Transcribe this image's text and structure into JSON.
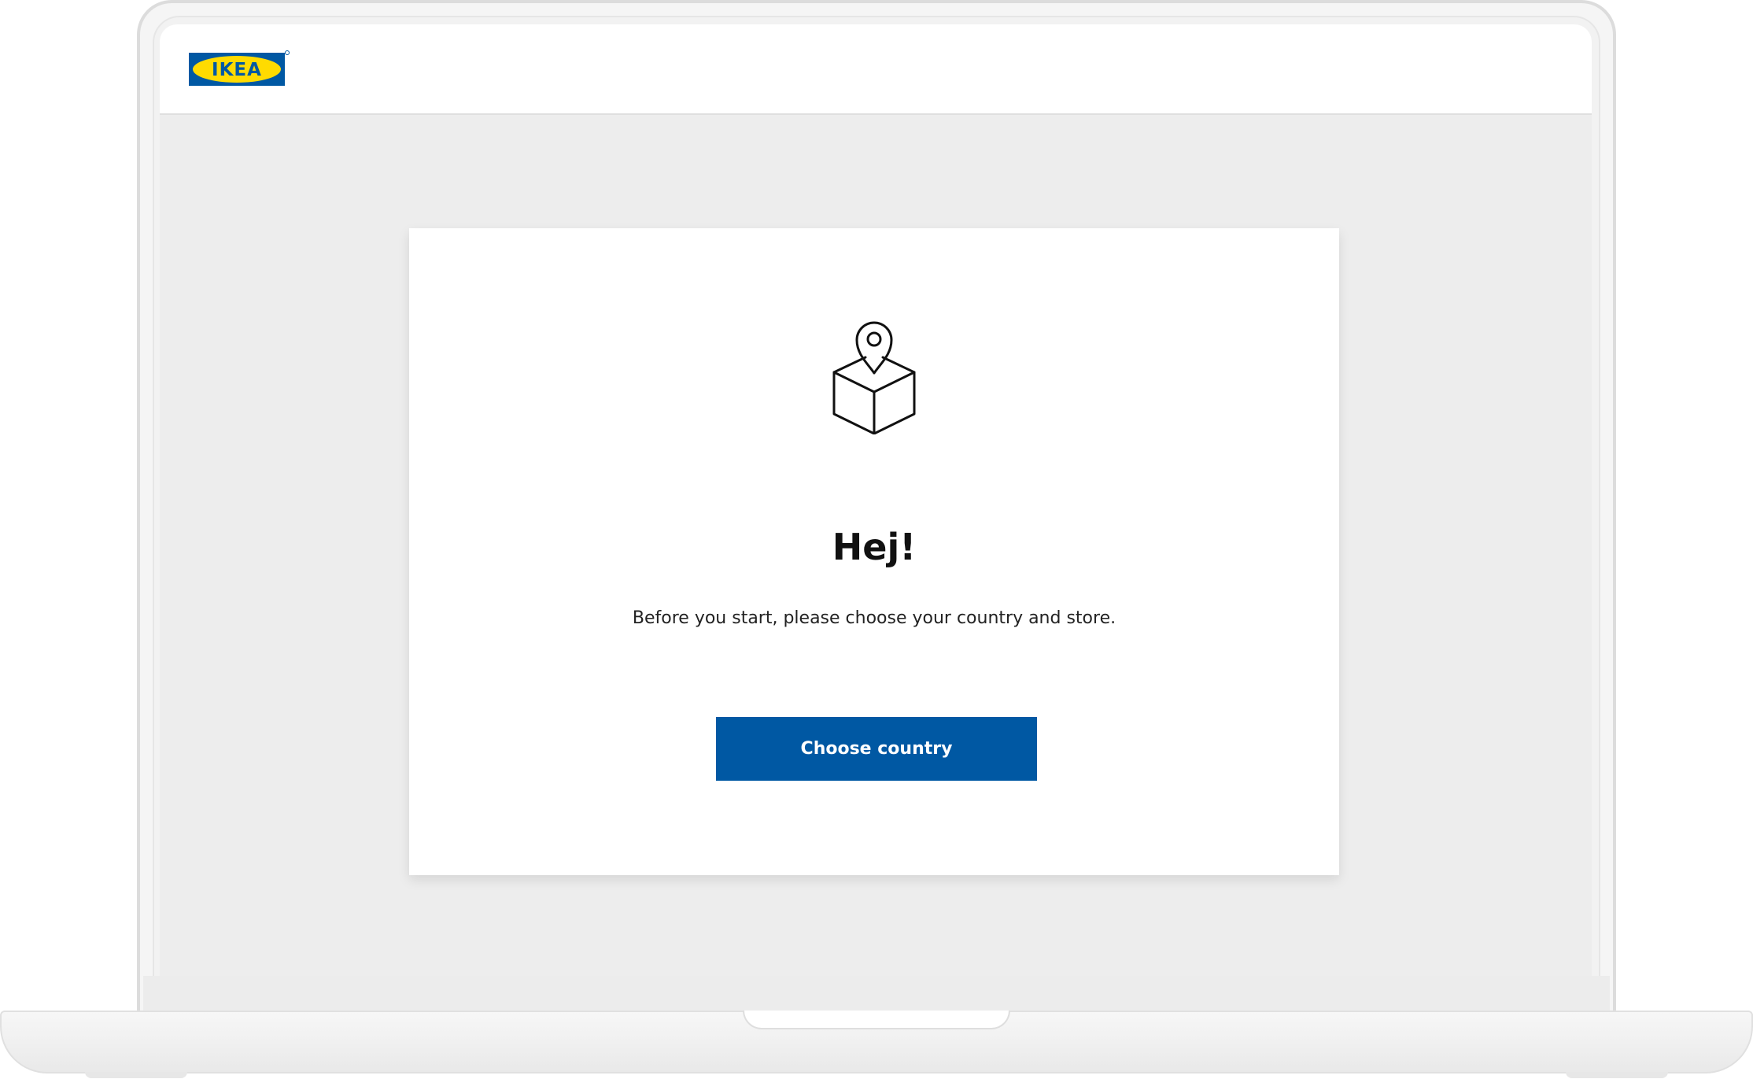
{
  "header": {
    "logo_text": "IKEA"
  },
  "card": {
    "icon": "store-location-box-icon",
    "title": "Hej!",
    "message": "Before you start, please choose your country and store.",
    "button_label": "Choose country"
  },
  "colors": {
    "brand_blue": "#0058a3",
    "brand_yellow": "#ffdb00",
    "page_background": "#ededed"
  }
}
